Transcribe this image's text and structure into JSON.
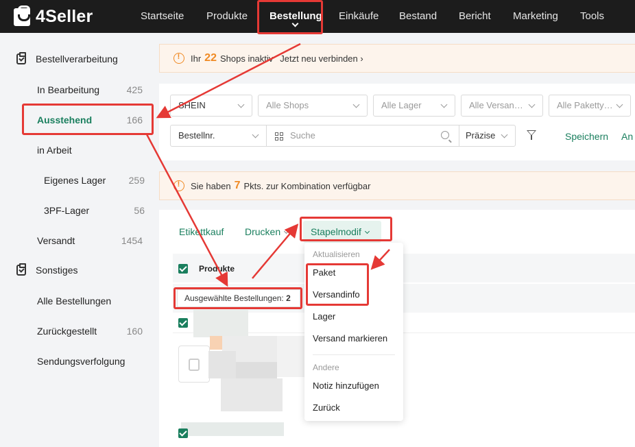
{
  "app": {
    "logo_text": "4Seller"
  },
  "nav": {
    "items": [
      "Startseite",
      "Produkte",
      "Bestellung",
      "Einkäufe",
      "Bestand",
      "Bericht",
      "Marketing",
      "Tools"
    ],
    "active": "Bestellung"
  },
  "sidebar": {
    "group1": "Bestellverarbeitung",
    "in_bearbeitung": {
      "label": "In Bearbeitung",
      "count": "425"
    },
    "ausstehend": {
      "label": "Ausstehend",
      "count": "166"
    },
    "in_arbeit": {
      "label": "in Arbeit"
    },
    "eigenes_lager": {
      "label": "Eigenes Lager",
      "count": "259"
    },
    "pf_lager": {
      "label": "3PF-Lager",
      "count": "56"
    },
    "versandt": {
      "label": "Versandt",
      "count": "1454"
    },
    "group2": "Sonstiges",
    "alle_bestellungen": {
      "label": "Alle Bestellungen"
    },
    "zurueckgestellt": {
      "label": "Zurückgestellt",
      "count": "160"
    },
    "sendungsverfolgung": {
      "label": "Sendungsverfolgung"
    }
  },
  "banner1": {
    "prefix": "Ihr",
    "num": "22",
    "text": "Shops inaktiv",
    "link": "Jetzt neu verbinden ›"
  },
  "filters": {
    "platform": "SHEIN",
    "shops": "Alle Shops",
    "lager": "Alle Lager",
    "versand": "Alle Versan…",
    "paket": "Alle Paketty…",
    "order_field": "Bestellnr.",
    "search_placeholder": "Suche",
    "match": "Präzise",
    "save": "Speichern",
    "extra": "An"
  },
  "banner2": {
    "prefix": "Sie haben",
    "num": "7",
    "text": "Pkts. zur Kombination verfügbar"
  },
  "toolbar": {
    "etikettkauf": "Etikettkauf",
    "drucken": "Drucken",
    "stapelmodif": "Stapelmodif"
  },
  "table": {
    "col_products": "Produkte",
    "selected_text": "Ausgewählte Bestellungen:",
    "selected_count": "2"
  },
  "dropdown": {
    "section1": "Aktualisieren",
    "paket": "Paket",
    "versandinfo": "Versandinfo",
    "lager": "Lager",
    "versand_markieren": "Versand markieren",
    "section2": "Andere",
    "notiz": "Notiz hinzufügen",
    "zurueck": "Zurück"
  },
  "colors": {
    "accent": "#1a7f5e",
    "warning": "#f08a24",
    "annotation": "#e53935",
    "topbar": "#1c1c1c"
  }
}
